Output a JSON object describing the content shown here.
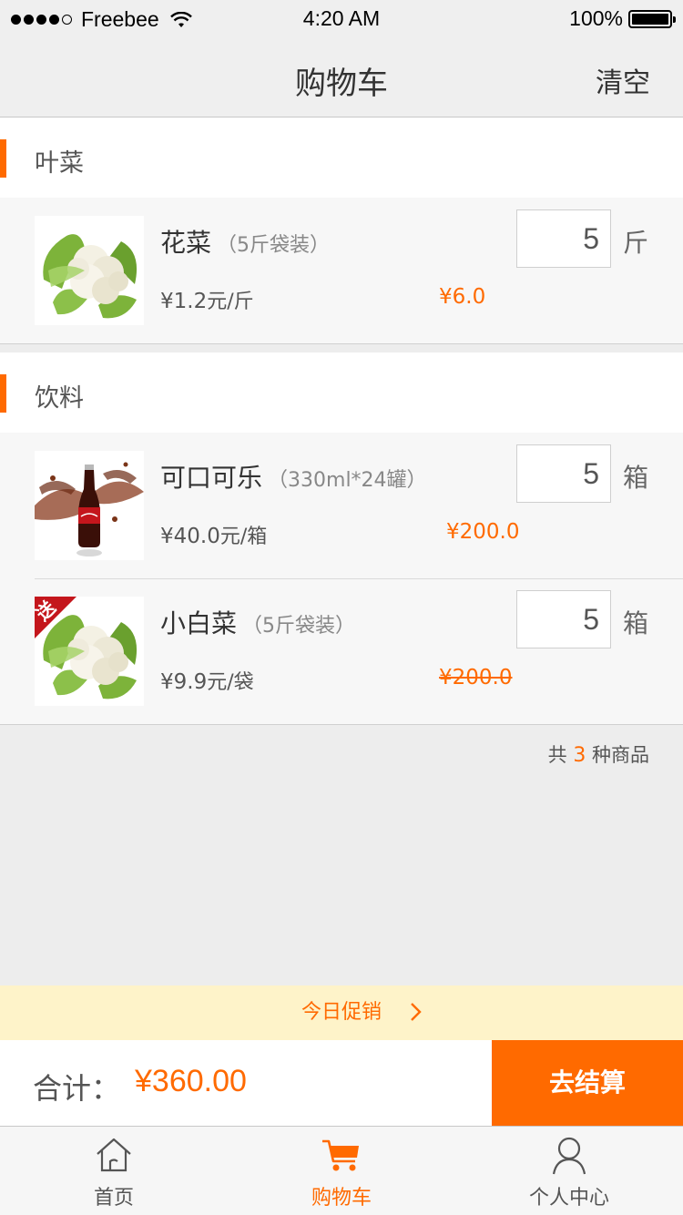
{
  "status_bar": {
    "carrier": "Freebee",
    "time": "4:20 AM",
    "battery": "100%"
  },
  "nav": {
    "title": "购物车",
    "clear_label": "清空"
  },
  "groups": [
    {
      "name": "叶菜",
      "items": [
        {
          "name": "花菜",
          "spec": "（5斤袋装）",
          "unit_price": "¥1.2",
          "unit_suffix": "元/斤",
          "line_total": "¥6.0",
          "quantity": "5",
          "quantity_unit": "斤",
          "gift": false
        }
      ]
    },
    {
      "name": "饮料",
      "items": [
        {
          "name": "可口可乐",
          "spec": "（330ml*24罐）",
          "unit_price": "¥40.0",
          "unit_suffix": "元/箱",
          "line_total": "¥200.0",
          "quantity": "5",
          "quantity_unit": "箱",
          "gift": false
        },
        {
          "name": "小白菜",
          "spec": "（5斤袋装）",
          "unit_price": "¥9.9",
          "unit_suffix": "元/袋",
          "line_total": "¥200.0",
          "quantity": "5",
          "quantity_unit": "箱",
          "gift": true,
          "gift_label": "送"
        }
      ]
    }
  ],
  "summary": {
    "count_prefix": "共",
    "count": "3",
    "count_suffix": "种商品"
  },
  "promo": {
    "label": "今日促销"
  },
  "checkout": {
    "total_label": "合计：",
    "total_value": "¥360.00",
    "button_label": "去结算"
  },
  "tabs": [
    {
      "label": "首页",
      "icon": "home-icon",
      "active": false
    },
    {
      "label": "购物车",
      "icon": "cart-icon",
      "active": true
    },
    {
      "label": "个人中心",
      "icon": "user-icon",
      "active": false
    }
  ],
  "colors": {
    "accent": "#ff6a00",
    "gift_badge": "#c4161c",
    "promo_bg": "#fef3c9"
  }
}
